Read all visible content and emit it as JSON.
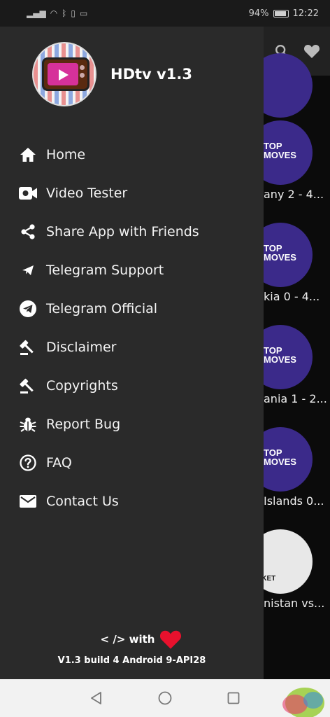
{
  "status_bar": {
    "battery_percent": "94%",
    "time": "12:22"
  },
  "drawer": {
    "app_title": "HDtv v1.3",
    "menu": [
      {
        "label": "Home",
        "icon": "home-icon"
      },
      {
        "label": "Video Tester",
        "icon": "video-camera-icon"
      },
      {
        "label": "Share App with Friends",
        "icon": "share-icon"
      },
      {
        "label": "Telegram Support",
        "icon": "send-icon"
      },
      {
        "label": "Telegram Official",
        "icon": "telegram-icon"
      },
      {
        "label": "Disclaimer",
        "icon": "gavel-icon"
      },
      {
        "label": "Copyrights",
        "icon": "gavel-icon"
      },
      {
        "label": "Report Bug",
        "icon": "bug-icon"
      },
      {
        "label": "FAQ",
        "icon": "help-circle-icon"
      },
      {
        "label": "Contact Us",
        "icon": "mail-icon"
      }
    ],
    "footer": {
      "made_with": "< /> with",
      "build_info": "V1.3 build 4 Android 9-API28"
    }
  },
  "background_list": {
    "items": [
      {
        "thumb_text": "TOP\nMOVES",
        "caption": "any 2 - 4..."
      },
      {
        "thumb_text": "TOP\nMOVES",
        "caption": "kia 0 - 4..."
      },
      {
        "thumb_text": "TOP\nMOVES",
        "caption": "ania 1 - 2..."
      },
      {
        "thumb_text": "TOP\nMOVES",
        "caption": "Islands 0..."
      },
      {
        "thumb_text": "RICKET",
        "caption": "nistan vs..."
      }
    ]
  },
  "colors": {
    "drawer_bg": "#2a2a2a",
    "accent_red": "#e8112d",
    "thumb_purple": "#3b2a8a"
  }
}
